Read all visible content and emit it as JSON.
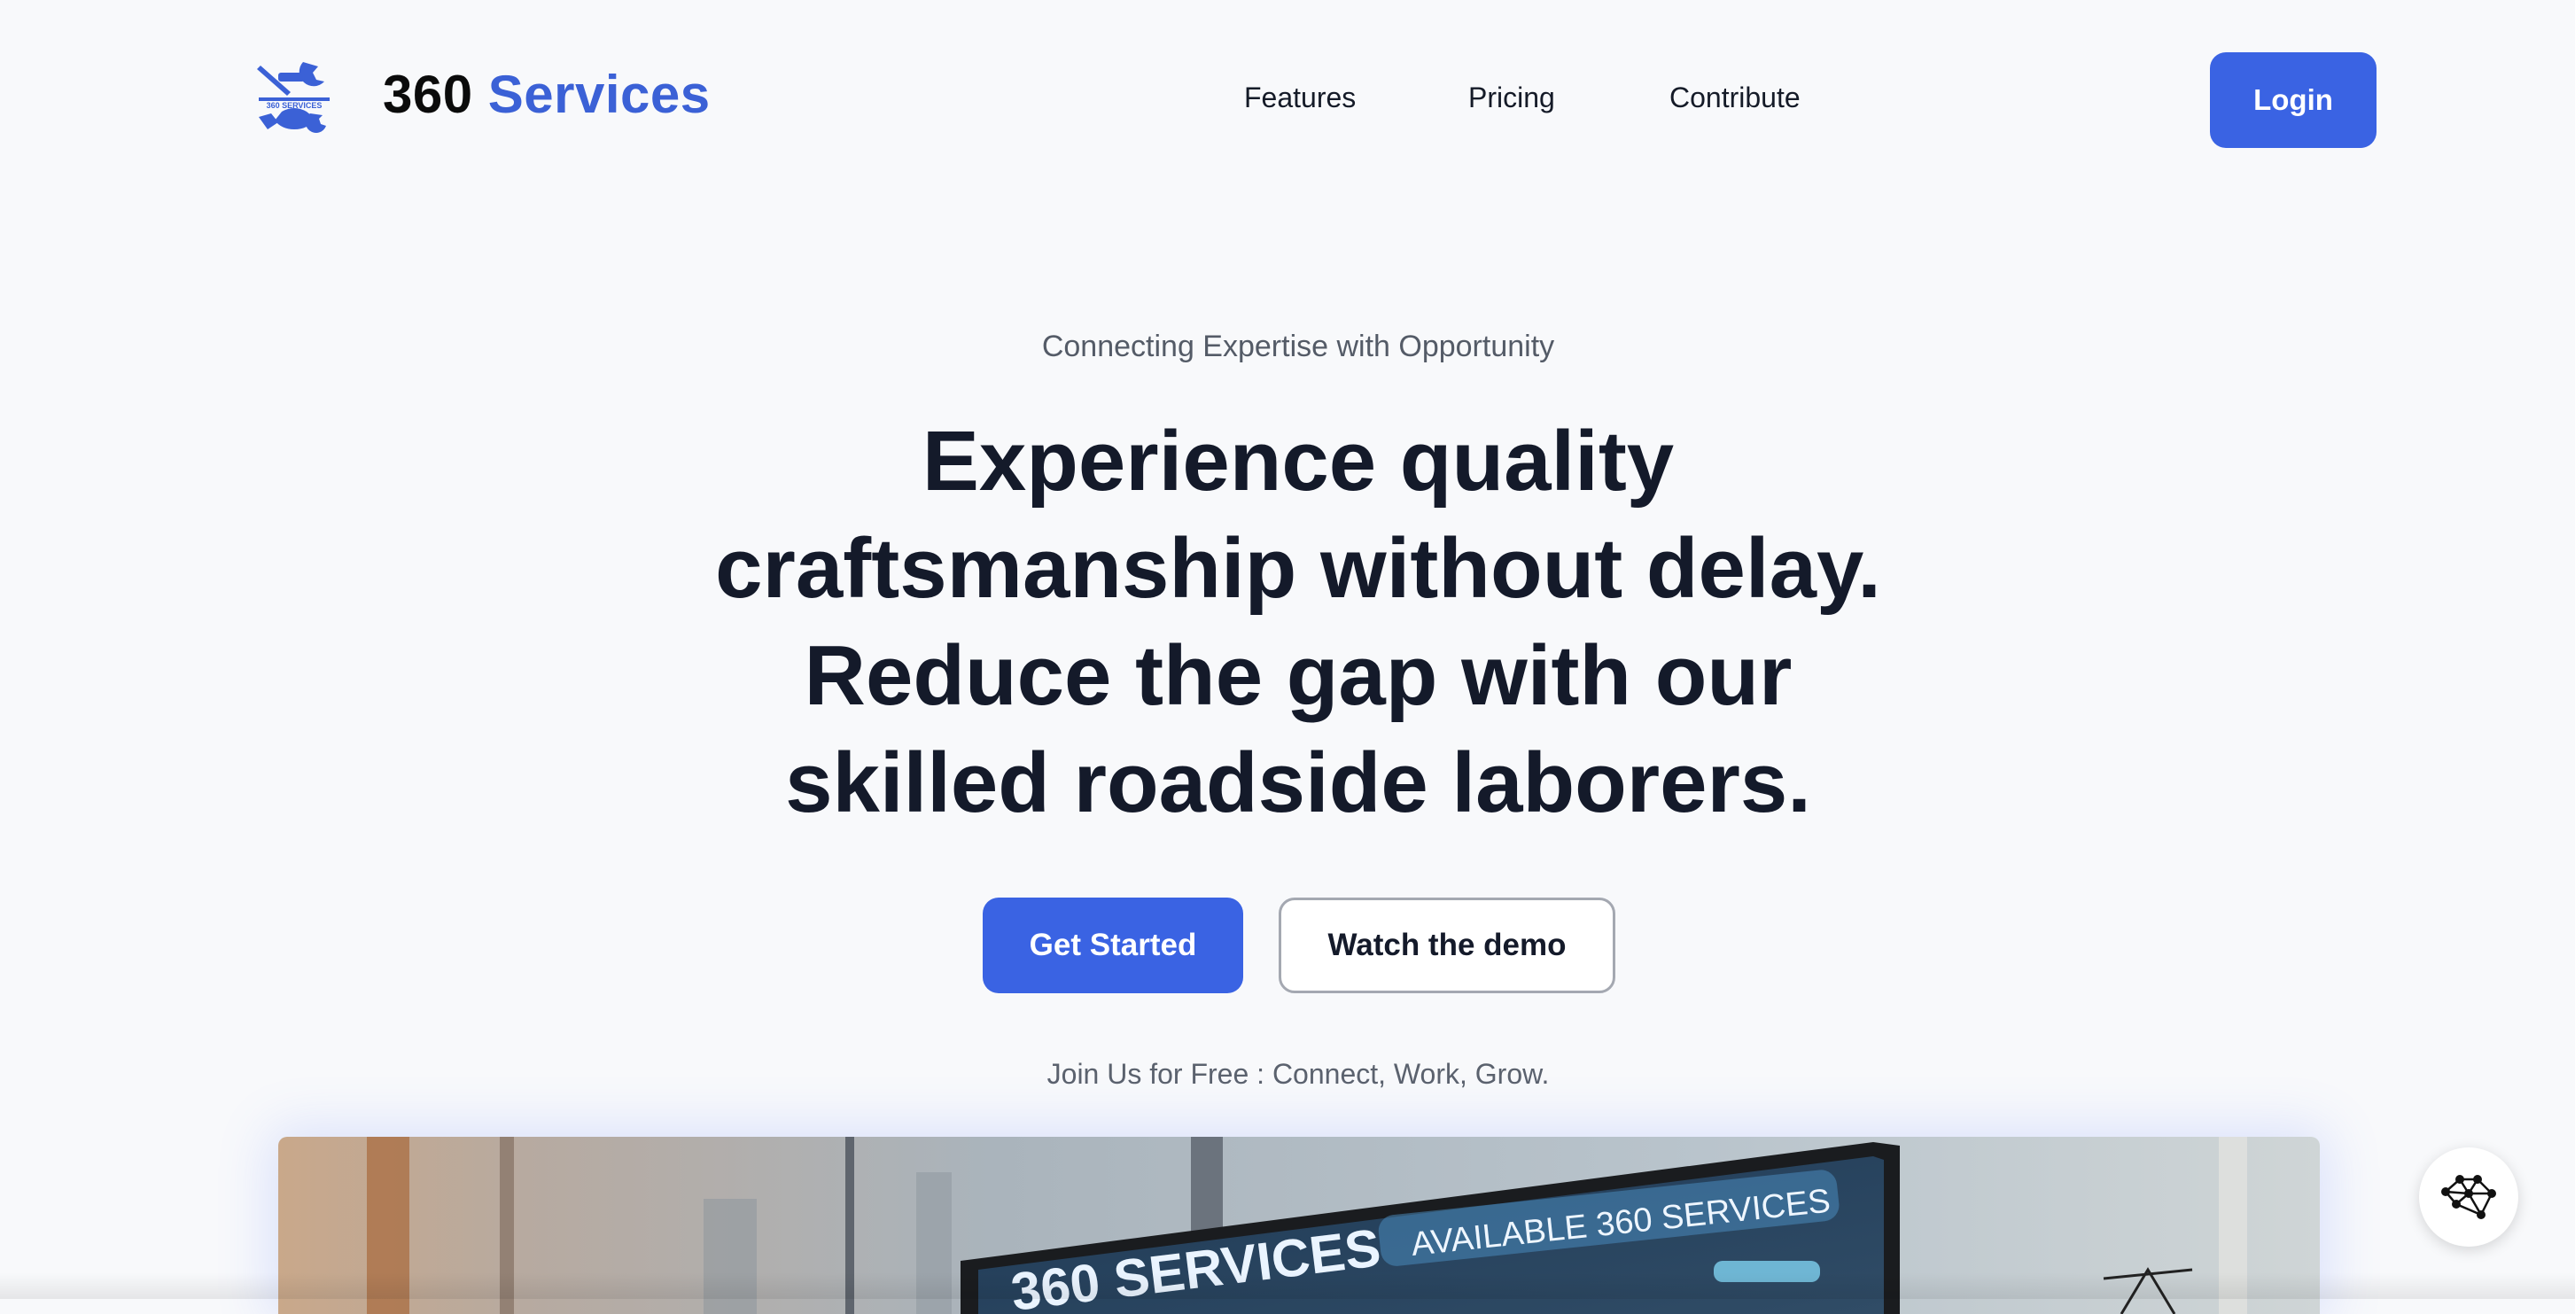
{
  "brand": {
    "name_part1": "360",
    "name_part2": "Services",
    "logo_icon": "wrench-crossed-logo-icon",
    "logo_text": "360 SERVICES",
    "colors": {
      "accent": "#3b61d6",
      "primary_button": "#3a63e3"
    }
  },
  "nav": {
    "items": [
      {
        "label": "Features"
      },
      {
        "label": "Pricing"
      },
      {
        "label": "Contribute"
      }
    ],
    "login_label": "Login"
  },
  "hero": {
    "eyebrow": "Connecting Expertise with Opportunity",
    "headline_line1": "Experience quality",
    "headline_line2": "craftsmanship without delay.",
    "headline_line3": "Reduce the gap with our",
    "headline_line4": "skilled roadside laborers.",
    "cta_primary": "Get Started",
    "cta_secondary": "Watch the demo",
    "subtext": "Join Us for Free : Connect, Work, Grow."
  },
  "hero_image": {
    "screen_title": "360 SERVICES",
    "screen_subtitle": "AVAILABLE 360 SERVICES"
  },
  "widget": {
    "icon": "network-graph-icon"
  }
}
